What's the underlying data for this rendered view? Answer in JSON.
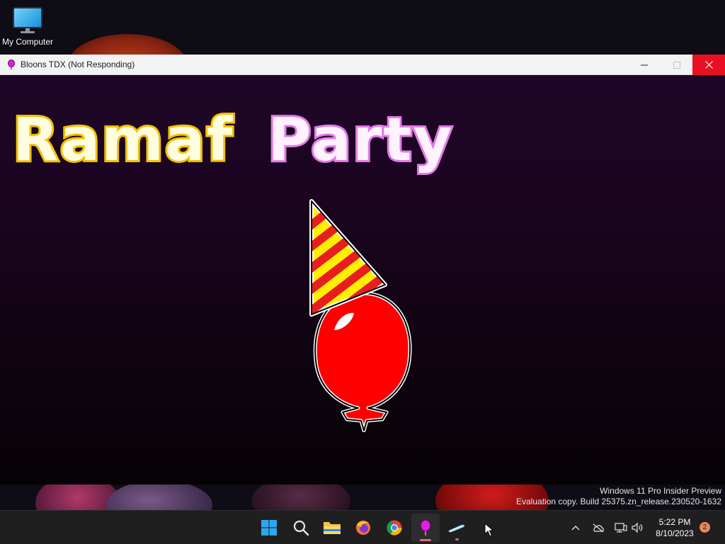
{
  "desktop": {
    "icons": [
      {
        "label": "My Computer",
        "icon": "computer-icon"
      }
    ]
  },
  "window": {
    "title": "Bloons TDX (Not Responding)",
    "title_icon": "balloon-icon",
    "controls": {
      "minimize_icon": "minimize-icon",
      "maximize_icon": "maximize-icon",
      "close_icon": "close-icon"
    }
  },
  "game": {
    "title_word_1": "Ramaf",
    "title_word_2": "Party",
    "colors": {
      "word_1_fill": "#fffde0",
      "word_1_outline": "#f2c200",
      "word_2_fill": "#fff2ff",
      "word_2_outline": "#e27ae6",
      "balloon": "#ff0000",
      "hat_stripe_a": "#ffee00",
      "hat_stripe_b": "#e81e1e"
    }
  },
  "watermark": {
    "line1": "Windows 11 Pro Insider Preview",
    "line2": "Evaluation copy. Build 25375.zn_release.230520-1632"
  },
  "taskbar": {
    "items": [
      {
        "name": "start",
        "icon": "windows-start-icon"
      },
      {
        "name": "search",
        "icon": "search-icon"
      },
      {
        "name": "file-explorer",
        "icon": "folder-icon"
      },
      {
        "name": "firefox",
        "icon": "firefox-icon"
      },
      {
        "name": "chrome",
        "icon": "chrome-icon"
      },
      {
        "name": "bloons",
        "icon": "balloon-icon",
        "active": true
      },
      {
        "name": "app",
        "icon": "hoverboard-icon"
      }
    ],
    "tray": {
      "overflow_icon": "chevron-up-icon",
      "cloud_icon": "onedrive-offline-icon",
      "network_icon": "network-icon",
      "volume_icon": "speaker-icon",
      "time": "5:22 PM",
      "date": "8/10/2023",
      "notification_count": "2"
    }
  }
}
